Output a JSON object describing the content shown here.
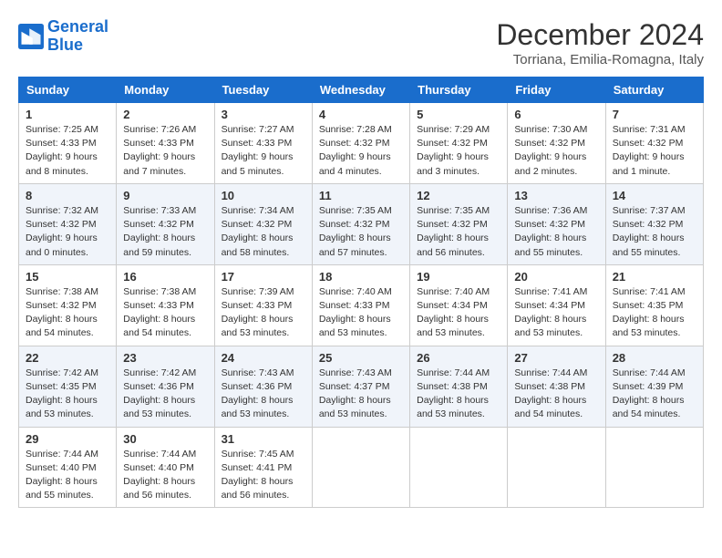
{
  "logo": {
    "text_general": "General",
    "text_blue": "Blue"
  },
  "header": {
    "month": "December 2024",
    "location": "Torriana, Emilia-Romagna, Italy"
  },
  "weekdays": [
    "Sunday",
    "Monday",
    "Tuesday",
    "Wednesday",
    "Thursday",
    "Friday",
    "Saturday"
  ],
  "weeks": [
    [
      {
        "day": "1",
        "sunrise": "7:25 AM",
        "sunset": "4:33 PM",
        "daylight": "9 hours and 8 minutes."
      },
      {
        "day": "2",
        "sunrise": "7:26 AM",
        "sunset": "4:33 PM",
        "daylight": "9 hours and 7 minutes."
      },
      {
        "day": "3",
        "sunrise": "7:27 AM",
        "sunset": "4:33 PM",
        "daylight": "9 hours and 5 minutes."
      },
      {
        "day": "4",
        "sunrise": "7:28 AM",
        "sunset": "4:32 PM",
        "daylight": "9 hours and 4 minutes."
      },
      {
        "day": "5",
        "sunrise": "7:29 AM",
        "sunset": "4:32 PM",
        "daylight": "9 hours and 3 minutes."
      },
      {
        "day": "6",
        "sunrise": "7:30 AM",
        "sunset": "4:32 PM",
        "daylight": "9 hours and 2 minutes."
      },
      {
        "day": "7",
        "sunrise": "7:31 AM",
        "sunset": "4:32 PM",
        "daylight": "9 hours and 1 minute."
      }
    ],
    [
      {
        "day": "8",
        "sunrise": "7:32 AM",
        "sunset": "4:32 PM",
        "daylight": "9 hours and 0 minutes."
      },
      {
        "day": "9",
        "sunrise": "7:33 AM",
        "sunset": "4:32 PM",
        "daylight": "8 hours and 59 minutes."
      },
      {
        "day": "10",
        "sunrise": "7:34 AM",
        "sunset": "4:32 PM",
        "daylight": "8 hours and 58 minutes."
      },
      {
        "day": "11",
        "sunrise": "7:35 AM",
        "sunset": "4:32 PM",
        "daylight": "8 hours and 57 minutes."
      },
      {
        "day": "12",
        "sunrise": "7:35 AM",
        "sunset": "4:32 PM",
        "daylight": "8 hours and 56 minutes."
      },
      {
        "day": "13",
        "sunrise": "7:36 AM",
        "sunset": "4:32 PM",
        "daylight": "8 hours and 55 minutes."
      },
      {
        "day": "14",
        "sunrise": "7:37 AM",
        "sunset": "4:32 PM",
        "daylight": "8 hours and 55 minutes."
      }
    ],
    [
      {
        "day": "15",
        "sunrise": "7:38 AM",
        "sunset": "4:32 PM",
        "daylight": "8 hours and 54 minutes."
      },
      {
        "day": "16",
        "sunrise": "7:38 AM",
        "sunset": "4:33 PM",
        "daylight": "8 hours and 54 minutes."
      },
      {
        "day": "17",
        "sunrise": "7:39 AM",
        "sunset": "4:33 PM",
        "daylight": "8 hours and 53 minutes."
      },
      {
        "day": "18",
        "sunrise": "7:40 AM",
        "sunset": "4:33 PM",
        "daylight": "8 hours and 53 minutes."
      },
      {
        "day": "19",
        "sunrise": "7:40 AM",
        "sunset": "4:34 PM",
        "daylight": "8 hours and 53 minutes."
      },
      {
        "day": "20",
        "sunrise": "7:41 AM",
        "sunset": "4:34 PM",
        "daylight": "8 hours and 53 minutes."
      },
      {
        "day": "21",
        "sunrise": "7:41 AM",
        "sunset": "4:35 PM",
        "daylight": "8 hours and 53 minutes."
      }
    ],
    [
      {
        "day": "22",
        "sunrise": "7:42 AM",
        "sunset": "4:35 PM",
        "daylight": "8 hours and 53 minutes."
      },
      {
        "day": "23",
        "sunrise": "7:42 AM",
        "sunset": "4:36 PM",
        "daylight": "8 hours and 53 minutes."
      },
      {
        "day": "24",
        "sunrise": "7:43 AM",
        "sunset": "4:36 PM",
        "daylight": "8 hours and 53 minutes."
      },
      {
        "day": "25",
        "sunrise": "7:43 AM",
        "sunset": "4:37 PM",
        "daylight": "8 hours and 53 minutes."
      },
      {
        "day": "26",
        "sunrise": "7:44 AM",
        "sunset": "4:38 PM",
        "daylight": "8 hours and 53 minutes."
      },
      {
        "day": "27",
        "sunrise": "7:44 AM",
        "sunset": "4:38 PM",
        "daylight": "8 hours and 54 minutes."
      },
      {
        "day": "28",
        "sunrise": "7:44 AM",
        "sunset": "4:39 PM",
        "daylight": "8 hours and 54 minutes."
      }
    ],
    [
      {
        "day": "29",
        "sunrise": "7:44 AM",
        "sunset": "4:40 PM",
        "daylight": "8 hours and 55 minutes."
      },
      {
        "day": "30",
        "sunrise": "7:44 AM",
        "sunset": "4:40 PM",
        "daylight": "8 hours and 56 minutes."
      },
      {
        "day": "31",
        "sunrise": "7:45 AM",
        "sunset": "4:41 PM",
        "daylight": "8 hours and 56 minutes."
      },
      null,
      null,
      null,
      null
    ]
  ]
}
